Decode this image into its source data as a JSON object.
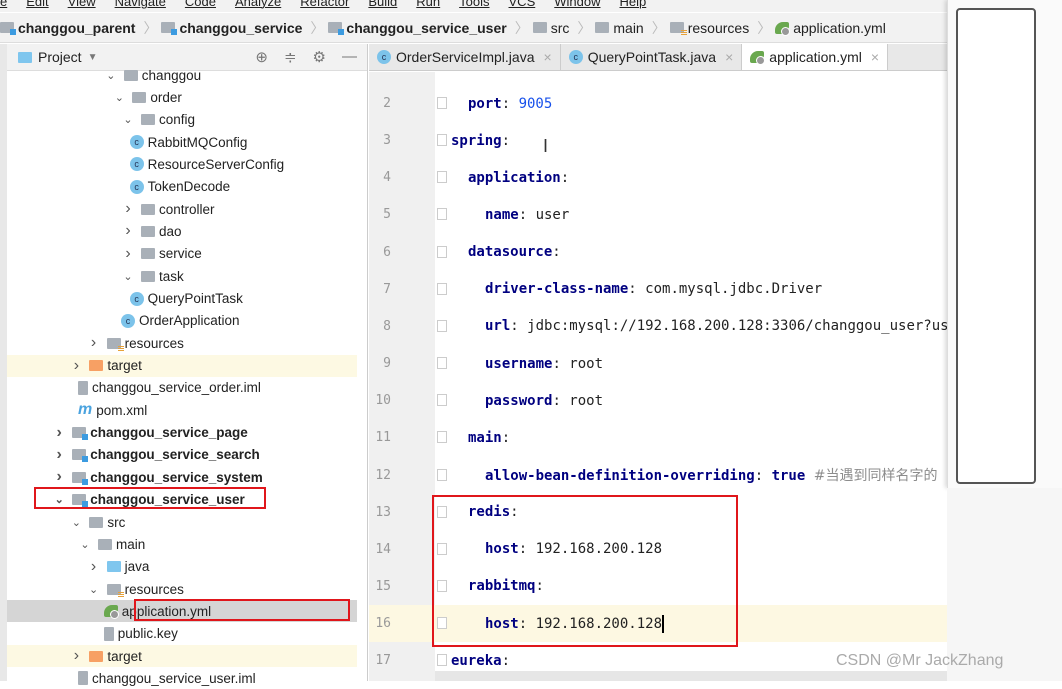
{
  "menu": [
    "e",
    "Edit",
    "View",
    "Navigate",
    "Code",
    "Analyze",
    "Refactor",
    "Build",
    "Run",
    "Tools",
    "VCS",
    "Window",
    "Help"
  ],
  "breadcrumb": [
    "changgou_parent",
    "changgou_service",
    "changgou_service_user",
    "src",
    "main",
    "resources",
    "application.yml"
  ],
  "project_panel": {
    "title": "Project",
    "tools": [
      "crosshair-icon",
      "collapse-icon",
      "gear-icon",
      "minimize-icon"
    ]
  },
  "tree": [
    {
      "label": "changgou",
      "depth": 8,
      "arrow": "down",
      "icon": "folder"
    },
    {
      "label": "order",
      "depth": 9,
      "arrow": "down",
      "icon": "folder"
    },
    {
      "label": "config",
      "depth": 10,
      "arrow": "down",
      "icon": "folder"
    },
    {
      "label": "RabbitMQConfig",
      "depth": 11,
      "icon": "class"
    },
    {
      "label": "ResourceServerConfig",
      "depth": 11,
      "icon": "class"
    },
    {
      "label": "TokenDecode",
      "depth": 11,
      "icon": "class"
    },
    {
      "label": "controller",
      "depth": 10,
      "arrow": "right",
      "icon": "folder"
    },
    {
      "label": "dao",
      "depth": 10,
      "arrow": "right",
      "icon": "folder"
    },
    {
      "label": "service",
      "depth": 10,
      "arrow": "right",
      "icon": "folder"
    },
    {
      "label": "task",
      "depth": 10,
      "arrow": "down",
      "icon": "folder"
    },
    {
      "label": "QueryPointTask",
      "depth": 11,
      "icon": "class"
    },
    {
      "label": "OrderApplication",
      "depth": 10,
      "icon": "spring-class"
    },
    {
      "label": "resources",
      "depth": 6,
      "arrow": "right",
      "icon": "resources"
    },
    {
      "label": "target",
      "depth": 4,
      "arrow": "right",
      "icon": "orange-folder",
      "highlight": true
    },
    {
      "label": "changgou_service_order.iml",
      "depth": 5,
      "icon": "file"
    },
    {
      "label": "pom.xml",
      "depth": 5,
      "icon": "maven"
    },
    {
      "label": "changgou_service_page",
      "depth": 2,
      "arrow": "right",
      "icon": "module",
      "bold": true
    },
    {
      "label": "changgou_service_search",
      "depth": 2,
      "arrow": "right",
      "icon": "module",
      "bold": true
    },
    {
      "label": "changgou_service_system",
      "depth": 2,
      "arrow": "right",
      "icon": "module",
      "bold": true
    },
    {
      "label": "changgou_service_user",
      "depth": 2,
      "arrow": "down",
      "icon": "module",
      "bold": true
    },
    {
      "label": "src",
      "depth": 4,
      "arrow": "down",
      "icon": "folder"
    },
    {
      "label": "main",
      "depth": 5,
      "arrow": "down",
      "icon": "folder"
    },
    {
      "label": "java",
      "depth": 6,
      "arrow": "right",
      "icon": "blue-folder"
    },
    {
      "label": "resources",
      "depth": 6,
      "arrow": "down",
      "icon": "resources"
    },
    {
      "label": "application.yml",
      "depth": 8,
      "icon": "spring",
      "selected": true
    },
    {
      "label": "public.key",
      "depth": 8,
      "icon": "file"
    },
    {
      "label": "target",
      "depth": 4,
      "arrow": "right",
      "icon": "orange-folder",
      "highlight": true
    },
    {
      "label": "changgou_service_user.iml",
      "depth": 5,
      "icon": "file"
    }
  ],
  "tabs": [
    {
      "label": "OrderServiceImpl.java",
      "icon": "class"
    },
    {
      "label": "QueryPointTask.java",
      "icon": "class"
    },
    {
      "label": "application.yml",
      "icon": "spring",
      "active": true
    }
  ],
  "code": [
    {
      "n": "2",
      "indent": 1,
      "key": "port",
      "value": "9005",
      "vtype": "num"
    },
    {
      "n": "3",
      "indent": 0,
      "key": "spring",
      "value": ""
    },
    {
      "n": "4",
      "indent": 1,
      "key": "application",
      "value": ""
    },
    {
      "n": "5",
      "indent": 2,
      "key": "name",
      "value": "user"
    },
    {
      "n": "6",
      "indent": 1,
      "key": "datasource",
      "value": ""
    },
    {
      "n": "7",
      "indent": 2,
      "key": "driver-class-name",
      "value": "com.mysql.jdbc.Driver"
    },
    {
      "n": "8",
      "indent": 2,
      "key": "url",
      "value": "jdbc:mysql://192.168.200.128:3306/changgou_user?us"
    },
    {
      "n": "9",
      "indent": 2,
      "key": "username",
      "value": "root"
    },
    {
      "n": "10",
      "indent": 2,
      "key": "password",
      "value": "root"
    },
    {
      "n": "11",
      "indent": 1,
      "key": "main",
      "value": ""
    },
    {
      "n": "12",
      "indent": 2,
      "key": "allow-bean-definition-overriding",
      "value": "true",
      "vtype": "bool",
      "comment": "#当遇到同样名字的"
    },
    {
      "n": "13",
      "indent": 1,
      "key": "redis",
      "value": ""
    },
    {
      "n": "14",
      "indent": 2,
      "key": "host",
      "value": "192.168.200.128"
    },
    {
      "n": "15",
      "indent": 1,
      "key": "rabbitmq",
      "value": ""
    },
    {
      "n": "16",
      "indent": 2,
      "key": "host",
      "value": "192.168.200.128",
      "current": true
    },
    {
      "n": "17",
      "indent": 0,
      "key": "eureka",
      "value": ""
    }
  ],
  "watermark": "CSDN @Mr JackZhang",
  "colors": {
    "highlight_box": "#e0161b",
    "key": "#000080",
    "number": "#1750eb",
    "current_line": "#fdf8e2"
  }
}
